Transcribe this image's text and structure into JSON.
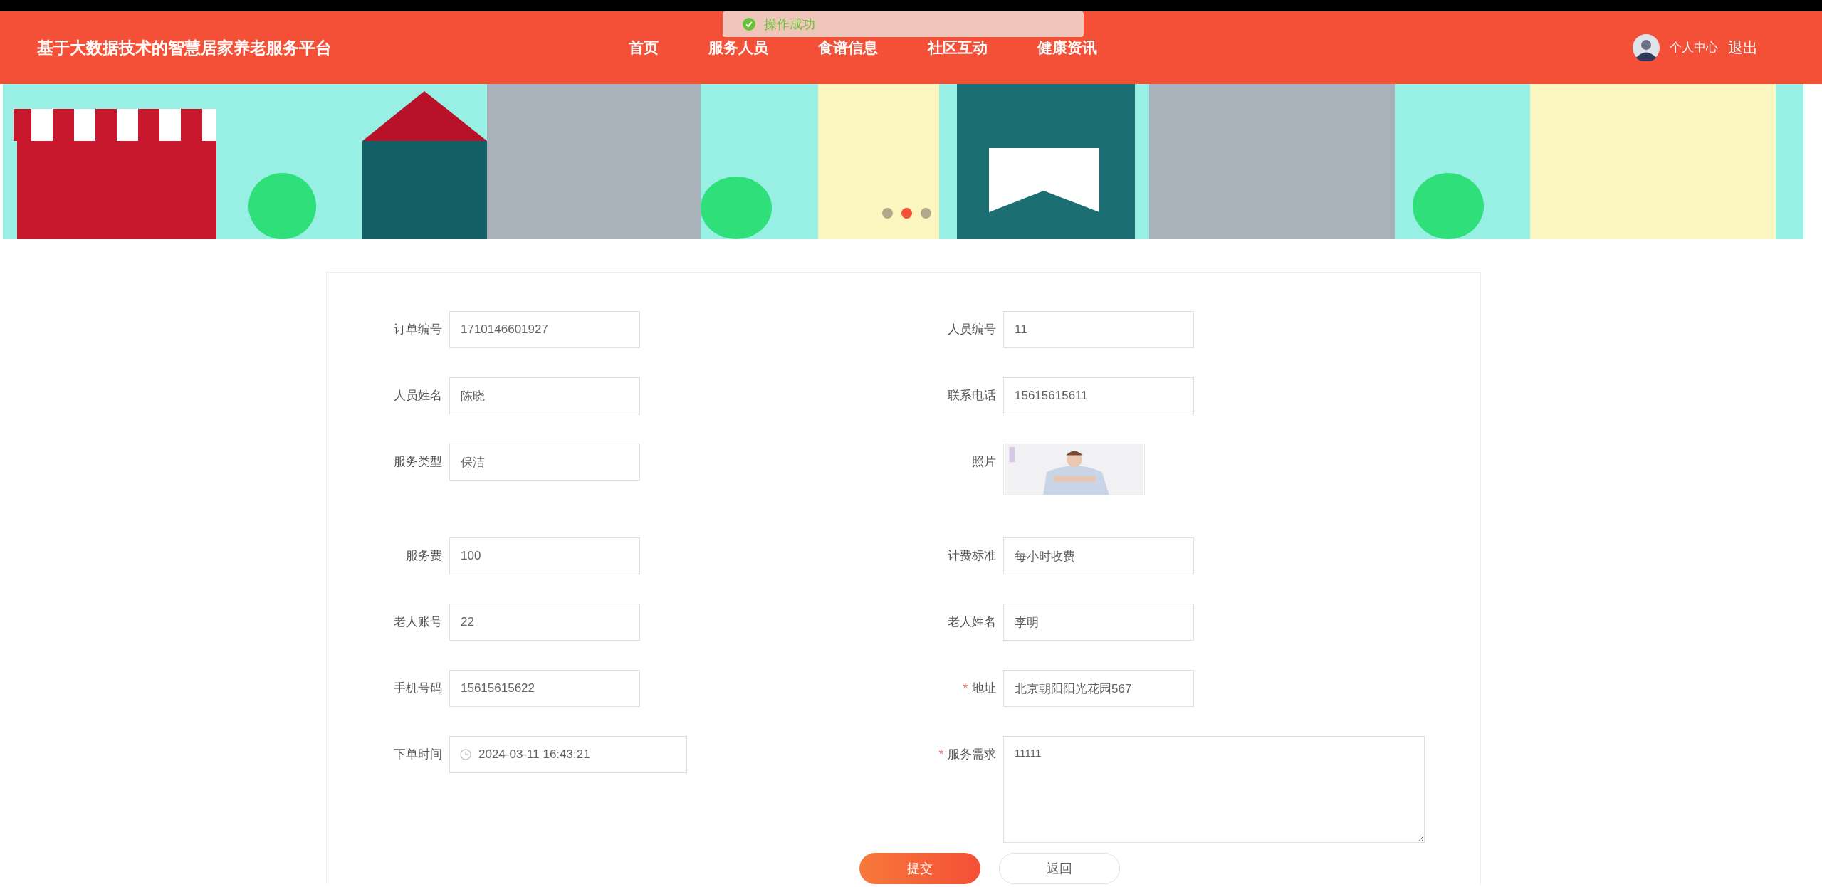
{
  "header": {
    "title": "基于大数据技术的智慧居家养老服务平台",
    "nav": [
      {
        "label": "首页"
      },
      {
        "label": "服务人员"
      },
      {
        "label": "食谱信息"
      },
      {
        "label": "社区互动"
      },
      {
        "label": "健康资讯"
      }
    ],
    "user_link": "个人中心",
    "logout": "退出"
  },
  "toast": {
    "text": "操作成功"
  },
  "banner": {
    "kind": "picture",
    "dots": [
      {
        "selected": false
      },
      {
        "selected": true
      },
      {
        "selected": false
      }
    ]
  },
  "form": {
    "fields": [
      {
        "kind": "text",
        "label": "订单编号",
        "value": "1710146601927"
      },
      {
        "kind": "text",
        "label": "人员编号",
        "value": "11"
      },
      {
        "kind": "text",
        "label": "人员姓名",
        "value": "陈晓"
      },
      {
        "kind": "text",
        "label": "联系电话",
        "value": "15615615611"
      },
      {
        "kind": "text",
        "label": "服务类型",
        "value": "保洁"
      },
      {
        "label": "照片"
      },
      {
        "kind": "text",
        "label": "服务费",
        "value": "100"
      },
      {
        "kind": "text",
        "label": "计费标准",
        "value": "每小时收费"
      },
      {
        "kind": "text",
        "label": "老人账号",
        "value": "22"
      },
      {
        "kind": "text",
        "label": "老人姓名",
        "value": "李明"
      },
      {
        "kind": "text",
        "label": "手机号码",
        "value": "15615615622"
      },
      {
        "kind": "text",
        "label": "地址",
        "value": "北京朝阳阳光花园567",
        "marker": "*"
      },
      {
        "kind": "datetime",
        "label": "下单时间",
        "value": "2024-03-11 16:43:21"
      },
      {
        "kind": "textarea",
        "label": "服务需求",
        "value": "11111",
        "marker": "*"
      }
    ],
    "buttons": [
      {
        "kind": "primary",
        "label": "提交"
      },
      {
        "kind": "secondary",
        "label": "返回"
      }
    ]
  }
}
